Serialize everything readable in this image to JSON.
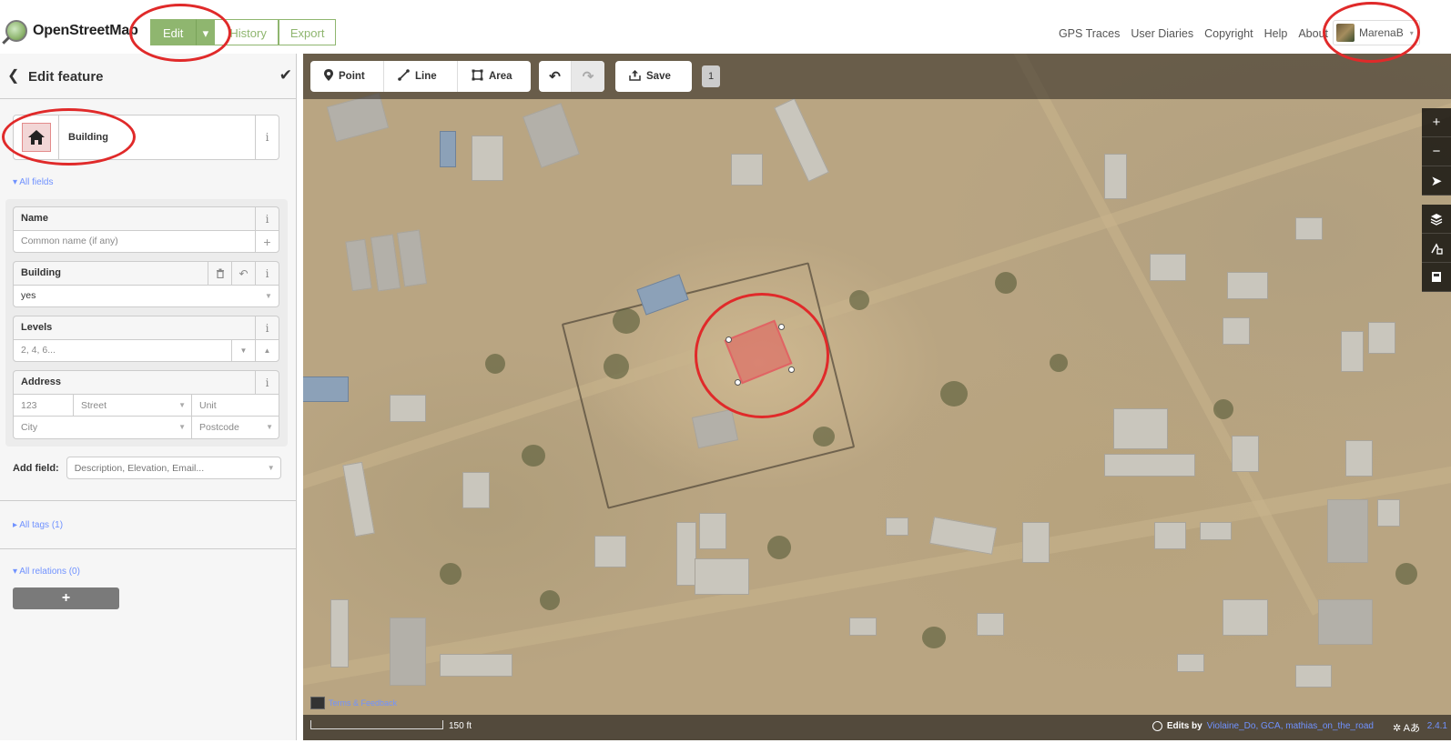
{
  "header": {
    "brand": "OpenStreetMap",
    "nav": {
      "edit": "Edit",
      "history": "History",
      "export": "Export"
    },
    "links": [
      "GPS Traces",
      "User Diaries",
      "Copyright",
      "Help",
      "About"
    ],
    "user": "MarenaB"
  },
  "sidebar": {
    "title": "Edit feature",
    "preset": "Building",
    "all_fields": "All fields",
    "fields": {
      "name": {
        "label": "Name",
        "placeholder": "Common name (if any)"
      },
      "building": {
        "label": "Building",
        "value": "yes"
      },
      "levels": {
        "label": "Levels",
        "placeholder": "2, 4, 6..."
      },
      "address": {
        "label": "Address",
        "housenumber": "123",
        "street": "Street",
        "unit": "Unit",
        "city": "City",
        "postcode": "Postcode"
      }
    },
    "add_field": {
      "label": "Add field:",
      "placeholder": "Description, Elevation, Email..."
    },
    "all_tags": "All tags (1)",
    "all_relations": "All relations (0)",
    "add_relation": "+"
  },
  "toolbar": {
    "point": "Point",
    "line": "Line",
    "area": "Area",
    "save": "Save",
    "changes_count": "1"
  },
  "map": {
    "terms": "Terms & Feedback",
    "scale": "150 ft",
    "edits_by_label": "Edits by",
    "edits_by_users": "Violaine_Do, GCA, mathias_on_the_road",
    "version": "2.4.1"
  },
  "colors": {
    "osm_green": "#8fb66f",
    "link_blue": "#7092ff",
    "annotation_red": "#e02a2a",
    "selected_building": "#e06464"
  },
  "icons": [
    "osm-logo-icon",
    "chevron-left-icon",
    "check-icon",
    "house-icon",
    "info-icon",
    "plus-icon",
    "trash-icon",
    "undo-icon",
    "redo-icon",
    "point-icon",
    "line-icon",
    "area-icon",
    "upload-icon",
    "zoom-in-icon",
    "zoom-out-icon",
    "locate-icon",
    "layers-icon",
    "map-data-icon",
    "help-icon"
  ]
}
